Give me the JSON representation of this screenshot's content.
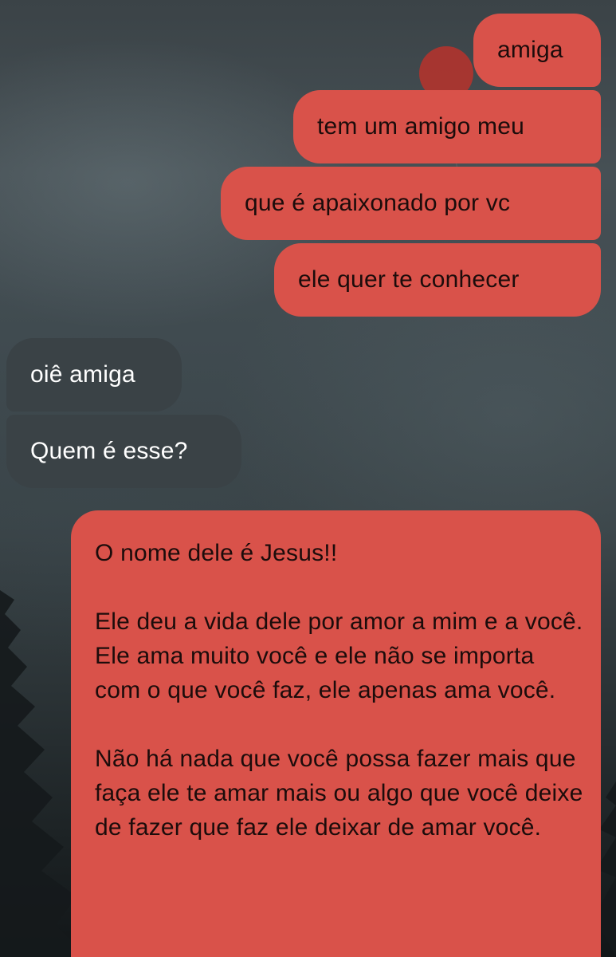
{
  "theme": {
    "outgoing_bubble_color": "#d9524a",
    "incoming_bubble_color": "#3a4246",
    "background_color": "#3f4a4f"
  },
  "messages": [
    {
      "direction": "outgoing",
      "text": "amiga"
    },
    {
      "direction": "outgoing",
      "text": "tem um amigo meu"
    },
    {
      "direction": "outgoing",
      "text": "que é apaixonado por vc"
    },
    {
      "direction": "outgoing",
      "text": "ele quer te conhecer"
    },
    {
      "direction": "incoming",
      "text": "oiê amiga"
    },
    {
      "direction": "incoming",
      "text": "Quem é esse?"
    },
    {
      "direction": "outgoing",
      "paragraphs": [
        "O nome dele é Jesus!!",
        "Ele deu a vida dele por amor a mim e a você. Ele ama muito você e ele não se importa com o que você faz, ele apenas ama você.",
        "Não há nada que você possa fazer mais que faça ele te amar mais ou algo que você deixe de fazer que faz ele deixar de amar você."
      ]
    }
  ]
}
